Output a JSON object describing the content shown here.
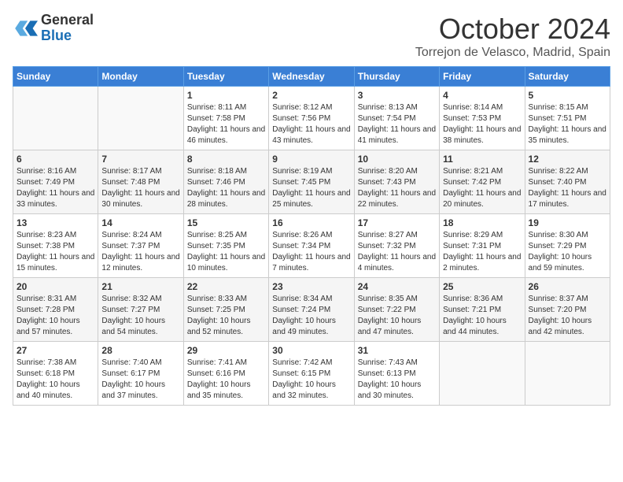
{
  "header": {
    "logo_line1": "General",
    "logo_line2": "Blue",
    "month": "October 2024",
    "location": "Torrejon de Velasco, Madrid, Spain"
  },
  "days_of_week": [
    "Sunday",
    "Monday",
    "Tuesday",
    "Wednesday",
    "Thursday",
    "Friday",
    "Saturday"
  ],
  "weeks": [
    [
      {
        "day": "",
        "info": ""
      },
      {
        "day": "",
        "info": ""
      },
      {
        "day": "1",
        "info": "Sunrise: 8:11 AM\nSunset: 7:58 PM\nDaylight: 11 hours and 46 minutes."
      },
      {
        "day": "2",
        "info": "Sunrise: 8:12 AM\nSunset: 7:56 PM\nDaylight: 11 hours and 43 minutes."
      },
      {
        "day": "3",
        "info": "Sunrise: 8:13 AM\nSunset: 7:54 PM\nDaylight: 11 hours and 41 minutes."
      },
      {
        "day": "4",
        "info": "Sunrise: 8:14 AM\nSunset: 7:53 PM\nDaylight: 11 hours and 38 minutes."
      },
      {
        "day": "5",
        "info": "Sunrise: 8:15 AM\nSunset: 7:51 PM\nDaylight: 11 hours and 35 minutes."
      }
    ],
    [
      {
        "day": "6",
        "info": "Sunrise: 8:16 AM\nSunset: 7:49 PM\nDaylight: 11 hours and 33 minutes."
      },
      {
        "day": "7",
        "info": "Sunrise: 8:17 AM\nSunset: 7:48 PM\nDaylight: 11 hours and 30 minutes."
      },
      {
        "day": "8",
        "info": "Sunrise: 8:18 AM\nSunset: 7:46 PM\nDaylight: 11 hours and 28 minutes."
      },
      {
        "day": "9",
        "info": "Sunrise: 8:19 AM\nSunset: 7:45 PM\nDaylight: 11 hours and 25 minutes."
      },
      {
        "day": "10",
        "info": "Sunrise: 8:20 AM\nSunset: 7:43 PM\nDaylight: 11 hours and 22 minutes."
      },
      {
        "day": "11",
        "info": "Sunrise: 8:21 AM\nSunset: 7:42 PM\nDaylight: 11 hours and 20 minutes."
      },
      {
        "day": "12",
        "info": "Sunrise: 8:22 AM\nSunset: 7:40 PM\nDaylight: 11 hours and 17 minutes."
      }
    ],
    [
      {
        "day": "13",
        "info": "Sunrise: 8:23 AM\nSunset: 7:38 PM\nDaylight: 11 hours and 15 minutes."
      },
      {
        "day": "14",
        "info": "Sunrise: 8:24 AM\nSunset: 7:37 PM\nDaylight: 11 hours and 12 minutes."
      },
      {
        "day": "15",
        "info": "Sunrise: 8:25 AM\nSunset: 7:35 PM\nDaylight: 11 hours and 10 minutes."
      },
      {
        "day": "16",
        "info": "Sunrise: 8:26 AM\nSunset: 7:34 PM\nDaylight: 11 hours and 7 minutes."
      },
      {
        "day": "17",
        "info": "Sunrise: 8:27 AM\nSunset: 7:32 PM\nDaylight: 11 hours and 4 minutes."
      },
      {
        "day": "18",
        "info": "Sunrise: 8:29 AM\nSunset: 7:31 PM\nDaylight: 11 hours and 2 minutes."
      },
      {
        "day": "19",
        "info": "Sunrise: 8:30 AM\nSunset: 7:29 PM\nDaylight: 10 hours and 59 minutes."
      }
    ],
    [
      {
        "day": "20",
        "info": "Sunrise: 8:31 AM\nSunset: 7:28 PM\nDaylight: 10 hours and 57 minutes."
      },
      {
        "day": "21",
        "info": "Sunrise: 8:32 AM\nSunset: 7:27 PM\nDaylight: 10 hours and 54 minutes."
      },
      {
        "day": "22",
        "info": "Sunrise: 8:33 AM\nSunset: 7:25 PM\nDaylight: 10 hours and 52 minutes."
      },
      {
        "day": "23",
        "info": "Sunrise: 8:34 AM\nSunset: 7:24 PM\nDaylight: 10 hours and 49 minutes."
      },
      {
        "day": "24",
        "info": "Sunrise: 8:35 AM\nSunset: 7:22 PM\nDaylight: 10 hours and 47 minutes."
      },
      {
        "day": "25",
        "info": "Sunrise: 8:36 AM\nSunset: 7:21 PM\nDaylight: 10 hours and 44 minutes."
      },
      {
        "day": "26",
        "info": "Sunrise: 8:37 AM\nSunset: 7:20 PM\nDaylight: 10 hours and 42 minutes."
      }
    ],
    [
      {
        "day": "27",
        "info": "Sunrise: 7:38 AM\nSunset: 6:18 PM\nDaylight: 10 hours and 40 minutes."
      },
      {
        "day": "28",
        "info": "Sunrise: 7:40 AM\nSunset: 6:17 PM\nDaylight: 10 hours and 37 minutes."
      },
      {
        "day": "29",
        "info": "Sunrise: 7:41 AM\nSunset: 6:16 PM\nDaylight: 10 hours and 35 minutes."
      },
      {
        "day": "30",
        "info": "Sunrise: 7:42 AM\nSunset: 6:15 PM\nDaylight: 10 hours and 32 minutes."
      },
      {
        "day": "31",
        "info": "Sunrise: 7:43 AM\nSunset: 6:13 PM\nDaylight: 10 hours and 30 minutes."
      },
      {
        "day": "",
        "info": ""
      },
      {
        "day": "",
        "info": ""
      }
    ]
  ]
}
